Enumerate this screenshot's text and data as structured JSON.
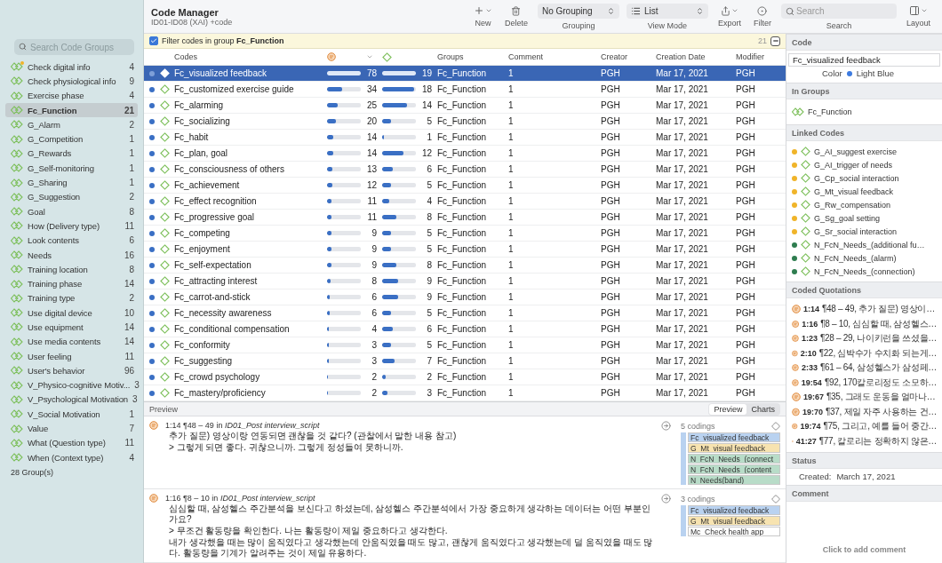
{
  "toolbar": {
    "title": "Code Manager",
    "subtitle": "ID01-ID08 (XAI) +code",
    "tools": [
      {
        "kind": "add",
        "label": "New"
      },
      {
        "kind": "trash",
        "label": "Delete"
      },
      {
        "kind": "select",
        "value": "No Grouping",
        "label": "Grouping"
      },
      {
        "kind": "listselect",
        "value": "List",
        "label": "View Mode"
      },
      {
        "kind": "export",
        "label": "Export"
      },
      {
        "kind": "filter",
        "label": "Filter"
      },
      {
        "kind": "search",
        "placeholder": "Search",
        "label": "Search"
      },
      {
        "kind": "layout",
        "label": "Layout"
      }
    ]
  },
  "filter_bar": {
    "checked": true,
    "text": "Filter codes in group **Fc_Function**",
    "count": "21"
  },
  "sidebar": {
    "search": {
      "placeholder": "Search Code Groups"
    },
    "items": [
      {
        "name": "Check digital info",
        "count": "4",
        "selected": false,
        "has_comment": true
      },
      {
        "name": "Check physiological info",
        "count": "9",
        "selected": false,
        "has_comment": false
      },
      {
        "name": "Exercise phase",
        "count": "4",
        "selected": false,
        "has_comment": false
      },
      {
        "name": "Fc_Function",
        "count": "21",
        "selected": true,
        "has_comment": false
      },
      {
        "name": "G_Alarm",
        "count": "2",
        "selected": false,
        "has_comment": false
      },
      {
        "name": "G_Competition",
        "count": "1",
        "selected": false,
        "has_comment": false
      },
      {
        "name": "G_Rewards",
        "count": "1",
        "selected": false,
        "has_comment": false
      },
      {
        "name": "G_Self-monitoring",
        "count": "1",
        "selected": false,
        "has_comment": false
      },
      {
        "name": "G_Sharing",
        "count": "1",
        "selected": false,
        "has_comment": false
      },
      {
        "name": "G_Suggestion",
        "count": "2",
        "selected": false,
        "has_comment": false
      },
      {
        "name": "Goal",
        "count": "8",
        "selected": false,
        "has_comment": false
      },
      {
        "name": "How (Delivery type)",
        "count": "11",
        "selected": false,
        "has_comment": false
      },
      {
        "name": "Look contents",
        "count": "6",
        "selected": false,
        "has_comment": false
      },
      {
        "name": "Needs",
        "count": "16",
        "selected": false,
        "has_comment": false
      },
      {
        "name": "Training location",
        "count": "8",
        "selected": false,
        "has_comment": false
      },
      {
        "name": "Training phase",
        "count": "14",
        "selected": false,
        "has_comment": false
      },
      {
        "name": "Training type",
        "count": "2",
        "selected": false,
        "has_comment": false
      },
      {
        "name": "Use digital device",
        "count": "10",
        "selected": false,
        "has_comment": false
      },
      {
        "name": "Use equipment",
        "count": "14",
        "selected": false,
        "has_comment": false
      },
      {
        "name": "Use media contents",
        "count": "14",
        "selected": false,
        "has_comment": false
      },
      {
        "name": "User feeling",
        "count": "11",
        "selected": false,
        "has_comment": false
      },
      {
        "name": "User's behavior",
        "count": "96",
        "selected": false,
        "has_comment": false
      },
      {
        "name": "V_Physico-cognitive Motiv...",
        "count": "3",
        "selected": false,
        "has_comment": false
      },
      {
        "name": "V_Psychological Motivation",
        "count": "3",
        "selected": false,
        "has_comment": false
      },
      {
        "name": "V_Social Motivation",
        "count": "1",
        "selected": false,
        "has_comment": false
      },
      {
        "name": "Value",
        "count": "7",
        "selected": false,
        "has_comment": false
      },
      {
        "name": "What (Question type)",
        "count": "11",
        "selected": false,
        "has_comment": false
      },
      {
        "name": "When (Context type)",
        "count": "4",
        "selected": false,
        "has_comment": false
      }
    ],
    "footer": "28 Group(s)"
  },
  "table": {
    "columns": {
      "codes": "Codes",
      "groups": "Groups",
      "comment": "Comment",
      "creator": "Creator",
      "created": "Creation Date",
      "modifier": "Modifier"
    },
    "rows": [
      {
        "name": "Fc_visualized feedback",
        "quotations": "78",
        "quotation_bar": {
          "level": 1
        },
        "links": "19",
        "link_bar": {
          "level": 1
        },
        "groups": "Fc_Function",
        "comment": "1",
        "creator": "PGH",
        "date": "Mar 17, 2021",
        "modifier": "PGH",
        "selected": true
      },
      {
        "name": "Fc_customized exercise guide",
        "quotations": "34",
        "quotation_bar": {
          "level": 0.44
        },
        "links": "18",
        "link_bar": {
          "level": 0.95
        },
        "groups": "Fc_Function",
        "comment": "1",
        "creator": "PGH",
        "date": "Mar 17, 2021",
        "modifier": "PGH",
        "selected": false
      },
      {
        "name": "Fc_alarming",
        "quotations": "25",
        "quotation_bar": {
          "level": 0.32
        },
        "links": "14",
        "link_bar": {
          "level": 0.74
        },
        "groups": "Fc_Function",
        "comment": "1",
        "creator": "PGH",
        "date": "Mar 17, 2021",
        "modifier": "PGH",
        "selected": false
      },
      {
        "name": "Fc_socializing",
        "quotations": "20",
        "quotation_bar": {
          "level": 0.26
        },
        "links": "5",
        "link_bar": {
          "level": 0.26
        },
        "groups": "Fc_Function",
        "comment": "1",
        "creator": "PGH",
        "date": "Mar 17, 2021",
        "modifier": "PGH",
        "selected": false
      },
      {
        "name": "Fc_habit",
        "quotations": "14",
        "quotation_bar": {
          "level": 0.18
        },
        "links": "1",
        "link_bar": {
          "level": 0.05
        },
        "groups": "Fc_Function",
        "comment": "1",
        "creator": "PGH",
        "date": "Mar 17, 2021",
        "modifier": "PGH",
        "selected": false
      },
      {
        "name": "Fc_plan, goal",
        "quotations": "14",
        "quotation_bar": {
          "level": 0.18
        },
        "links": "12",
        "link_bar": {
          "level": 0.63
        },
        "groups": "Fc_Function",
        "comment": "1",
        "creator": "PGH",
        "date": "Mar 17, 2021",
        "modifier": "PGH",
        "selected": false
      },
      {
        "name": "Fc_consciousness of others",
        "quotations": "13",
        "quotation_bar": {
          "level": 0.17
        },
        "links": "6",
        "link_bar": {
          "level": 0.32
        },
        "groups": "Fc_Function",
        "comment": "1",
        "creator": "PGH",
        "date": "Mar 17, 2021",
        "modifier": "PGH",
        "selected": false
      },
      {
        "name": "Fc_achievement",
        "quotations": "12",
        "quotation_bar": {
          "level": 0.15
        },
        "links": "5",
        "link_bar": {
          "level": 0.26
        },
        "groups": "Fc_Function",
        "comment": "1",
        "creator": "PGH",
        "date": "Mar 17, 2021",
        "modifier": "PGH",
        "selected": false
      },
      {
        "name": "Fc_effect recognition",
        "quotations": "11",
        "quotation_bar": {
          "level": 0.14
        },
        "links": "4",
        "link_bar": {
          "level": 0.21
        },
        "groups": "Fc_Function",
        "comment": "1",
        "creator": "PGH",
        "date": "Mar 17, 2021",
        "modifier": "PGH",
        "selected": false
      },
      {
        "name": "Fc_progressive goal",
        "quotations": "11",
        "quotation_bar": {
          "level": 0.14
        },
        "links": "8",
        "link_bar": {
          "level": 0.42
        },
        "groups": "Fc_Function",
        "comment": "1",
        "creator": "PGH",
        "date": "Mar 17, 2021",
        "modifier": "PGH",
        "selected": false
      },
      {
        "name": "Fc_competing",
        "quotations": "9",
        "quotation_bar": {
          "level": 0.12
        },
        "links": "5",
        "link_bar": {
          "level": 0.26
        },
        "groups": "Fc_Function",
        "comment": "1",
        "creator": "PGH",
        "date": "Mar 17, 2021",
        "modifier": "PGH",
        "selected": false
      },
      {
        "name": "Fc_enjoyment",
        "quotations": "9",
        "quotation_bar": {
          "level": 0.12
        },
        "links": "5",
        "link_bar": {
          "level": 0.26
        },
        "groups": "Fc_Function",
        "comment": "1",
        "creator": "PGH",
        "date": "Mar 17, 2021",
        "modifier": "PGH",
        "selected": false
      },
      {
        "name": "Fc_self-expectation",
        "quotations": "9",
        "quotation_bar": {
          "level": 0.12
        },
        "links": "8",
        "link_bar": {
          "level": 0.42
        },
        "groups": "Fc_Function",
        "comment": "1",
        "creator": "PGH",
        "date": "Mar 17, 2021",
        "modifier": "PGH",
        "selected": false
      },
      {
        "name": "Fc_attracting interest",
        "quotations": "8",
        "quotation_bar": {
          "level": 0.1
        },
        "links": "9",
        "link_bar": {
          "level": 0.47
        },
        "groups": "Fc_Function",
        "comment": "1",
        "creator": "PGH",
        "date": "Mar 17, 2021",
        "modifier": "PGH",
        "selected": false
      },
      {
        "name": "Fc_carrot-and-stick",
        "quotations": "6",
        "quotation_bar": {
          "level": 0.08
        },
        "links": "9",
        "link_bar": {
          "level": 0.47
        },
        "groups": "Fc_Function",
        "comment": "1",
        "creator": "PGH",
        "date": "Mar 17, 2021",
        "modifier": "PGH",
        "selected": false
      },
      {
        "name": "Fc_necessity awareness",
        "quotations": "6",
        "quotation_bar": {
          "level": 0.08
        },
        "links": "5",
        "link_bar": {
          "level": 0.26
        },
        "groups": "Fc_Function",
        "comment": "1",
        "creator": "PGH",
        "date": "Mar 17, 2021",
        "modifier": "PGH",
        "selected": false
      },
      {
        "name": "Fc_conditional compensation",
        "quotations": "4",
        "quotation_bar": {
          "level": 0.05
        },
        "links": "6",
        "link_bar": {
          "level": 0.32
        },
        "groups": "Fc_Function",
        "comment": "1",
        "creator": "PGH",
        "date": "Mar 17, 2021",
        "modifier": "PGH",
        "selected": false
      },
      {
        "name": "Fc_conformity",
        "quotations": "3",
        "quotation_bar": {
          "level": 0.04
        },
        "links": "5",
        "link_bar": {
          "level": 0.26
        },
        "groups": "Fc_Function",
        "comment": "1",
        "creator": "PGH",
        "date": "Mar 17, 2021",
        "modifier": "PGH",
        "selected": false
      },
      {
        "name": "Fc_suggesting",
        "quotations": "3",
        "quotation_bar": {
          "level": 0.04
        },
        "links": "7",
        "link_bar": {
          "level": 0.37
        },
        "groups": "Fc_Function",
        "comment": "1",
        "creator": "PGH",
        "date": "Mar 17, 2021",
        "modifier": "PGH",
        "selected": false
      },
      {
        "name": "Fc_crowd psychology",
        "quotations": "2",
        "quotation_bar": {
          "level": 0.03
        },
        "links": "2",
        "link_bar": {
          "level": 0.11
        },
        "groups": "Fc_Function",
        "comment": "1",
        "creator": "PGH",
        "date": "Mar 17, 2021",
        "modifier": "PGH",
        "selected": false
      },
      {
        "name": "Fc_mastery/proficiency",
        "quotations": "2",
        "quotation_bar": {
          "level": 0.03
        },
        "links": "3",
        "link_bar": {
          "level": 0.16
        },
        "groups": "Fc_Function",
        "comment": "1",
        "creator": "PGH",
        "date": "Mar 17, 2021",
        "modifier": "PGH",
        "selected": false
      }
    ]
  },
  "preview": {
    "title": "Preview",
    "view_toggle": [
      {
        "label": "Preview",
        "selected": true
      },
      {
        "label": "Charts",
        "selected": false
      }
    ],
    "quotations": [
      {
        "title": "1:14 ¶48 – 49 in *ID01_Post interview_script*",
        "lines": [
          "추가 질문) 영상이랑 연동되면 괜찮을 것 같다? (관찰에서 말한 내용 참고)",
          "> 그렇게 되면 좋다. 귀찮으니까. 그렇게 정성들여 못하니까."
        ],
        "codings": "5 codings",
        "tags": [
          {
            "name": "Fc_visualized feedback",
            "color": "#b9d2f0"
          },
          {
            "name": "G_Mt_visual feedback",
            "color": "#f7e3b0"
          },
          {
            "name": "N_FcN_Needs_(connect",
            "color": "#b8dcc8"
          },
          {
            "name": "N_FcN_Needs_(content",
            "color": "#b8dcc8"
          },
          {
            "name": "N_Needs(band)",
            "color": "#b8dcc8"
          }
        ]
      },
      {
        "title": "1:16 ¶8 – 10 in *ID01_Post interview_script*",
        "lines": [
          "심심할 때, 삼성헬스 주간분석을 보신다고 하셨는데, 삼성헬스 주간분석에서 가장 중요하게 생각하는 데이터는 어떤 부분인가요?",
          "> 무조건 활동량을 확인한다. 나는 활동량이 제일 중요하다고 생각한다.",
          "내가 생각했을 때는 많이 움직였다고 생각했는데 안움직였을 때도 많고, 괜찮게 움직였다고 생각했는데 덜 움직였을 때도 많다. 활동량을 기계가 알려주는 것이 제일 유용하다."
        ],
        "codings": "3 codings",
        "tags": [
          {
            "name": "Fc_visualized feedback",
            "color": "#b9d2f0"
          },
          {
            "name": "G_Mt_visual feedback",
            "color": "#f7e3b0"
          },
          {
            "name": "Mc_Check health app",
            "color": "#ffffff"
          }
        ]
      }
    ]
  },
  "inspector": {
    "code_section": "Code",
    "code_name": "Fc_visualized feedback",
    "color_label": "Color",
    "color_name": "Light Blue",
    "color": "#3d7be0",
    "groups_section": "In Groups",
    "groups": [
      "Fc_Function"
    ],
    "linked_section": "Linked Codes",
    "linked": [
      {
        "name": "G_AI_suggest exercise",
        "color": "#f0b429"
      },
      {
        "name": "G_AI_trigger of needs",
        "color": "#f0b429"
      },
      {
        "name": "G_Cp_social interaction",
        "color": "#f0b429"
      },
      {
        "name": "G_Mt_visual feedback",
        "color": "#f0b429"
      },
      {
        "name": "G_Rw_compensation",
        "color": "#f0b429"
      },
      {
        "name": "G_Sg_goal setting",
        "color": "#f0b429"
      },
      {
        "name": "G_Sr_social interaction",
        "color": "#f0b429"
      },
      {
        "name": "N_FcN_Needs_(additional fu…",
        "color": "#2e7d4f"
      },
      {
        "name": "N_FcN_Needs_(alarm)",
        "color": "#2e7d4f"
      },
      {
        "name": "N_FcN_Needs_(connection)",
        "color": "#2e7d4f"
      }
    ],
    "quotations_section": "Coded Quotations",
    "quotations": [
      {
        "id": "1:14",
        "text": "¶48 – 49, 추가 질문) 영상이…"
      },
      {
        "id": "1:16",
        "text": "¶8 – 10, 심심할 때, 삼성헬스…"
      },
      {
        "id": "1:23",
        "text": "¶28 – 29, 나이키런을 쓰셨을…"
      },
      {
        "id": "2:10",
        "text": "¶22, 심박수가 수치화 되는게…"
      },
      {
        "id": "2:33",
        "text": "¶61 – 64, 삼성헬스가 삼성페…"
      },
      {
        "id": "19:54",
        "text": "¶92, 170칼로리정도 소모하…"
      },
      {
        "id": "19:67",
        "text": "¶35, 그래도 운동을 얼마나…"
      },
      {
        "id": "19:70",
        "text": "¶37, 제일 자주 사용하는 건…"
      },
      {
        "id": "19:74",
        "text": "¶75, 그리고, 예를 들어 중간…"
      },
      {
        "id": "41:27",
        "text": "¶77, 칼로리는 정확하지 않은…"
      }
    ],
    "status_section": "Status",
    "created_label": "Created:",
    "created": "March 17, 2021",
    "comment_section": "Comment",
    "comment_placeholder": "Click to add comment"
  }
}
